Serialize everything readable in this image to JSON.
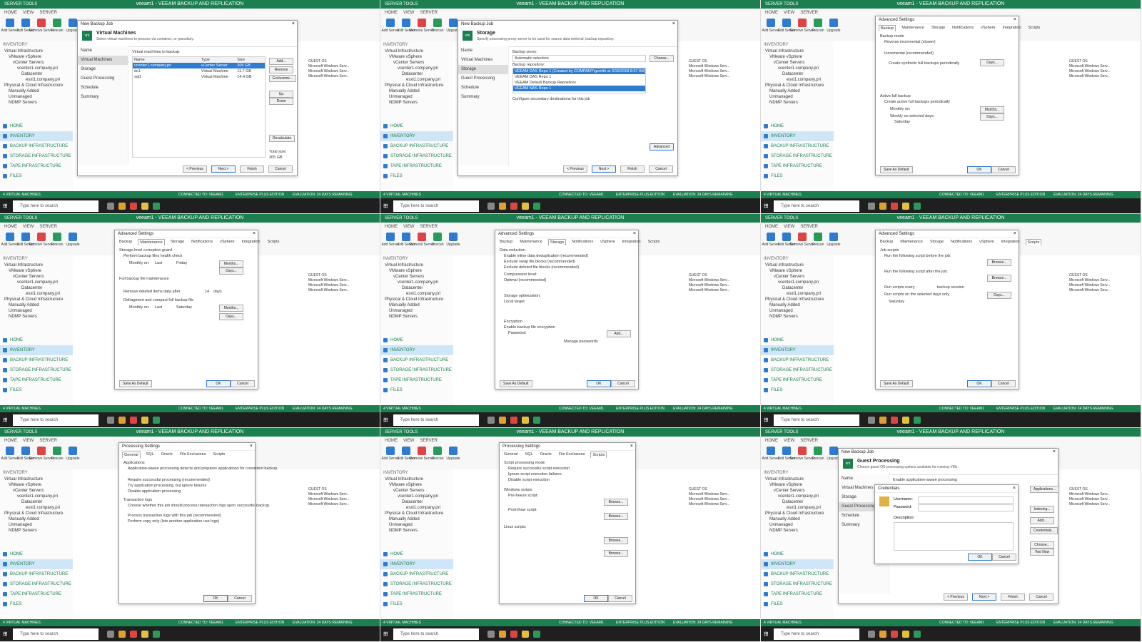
{
  "app": {
    "window_title": "veeam1 - VEEAM BACKUP AND REPLICATION",
    "server_tools": "SERVER TOOLS",
    "ribbon_tabs": [
      "HOME",
      "VIEW",
      "SERVER"
    ],
    "ribbon_buttons": [
      "Add Server",
      "Edit Server",
      "Remove Server",
      "Rescan",
      "Upgrade"
    ],
    "inventory_label": "INVENTORY",
    "tree": [
      "Virtual Infrastructure",
      "VMware vSphere",
      "vCenter Servers",
      "vcenter1.company.pri",
      "Datacenter",
      "esxi1.company.pri",
      "Physical & Cloud Infrastructure",
      "Manually Added",
      "Unmanaged",
      "NDMP Servers"
    ],
    "nav": [
      "HOME",
      "INVENTORY",
      "BACKUP INFRASTRUCTURE",
      "STORAGE INFRASTRUCTURE",
      "TAPE INFRASTRUCTURE",
      "FILES"
    ],
    "status": {
      "left": "4 VIRTUAL MACHINES",
      "connected": "CONNECTED TO: VEEAM1",
      "edition": "ENTERPRISE PLUS EDITION",
      "eval": "EVALUATION: 24 DAYS REMAINING"
    },
    "taskbar_search": "Type here to search",
    "bg_guest_os": "GUEST OS",
    "bg_os": "Microsoft Windows Serv..."
  },
  "tiles": [
    {
      "dialog_title": "New Backup Job",
      "header_title": "Virtual Machines",
      "header_sub": "Select virtual machines to process via container, or granularly.",
      "steps": [
        "Name",
        "Virtual Machines",
        "Storage",
        "Guest Processing",
        "Schedule",
        "Summary"
      ],
      "active_step": 1,
      "list_label": "Virtual machines to backup:",
      "columns": [
        "Name",
        "Type",
        "Size"
      ],
      "rows": [
        {
          "name": "vcenter1.company.pri",
          "type": "vCenter Server",
          "size": "305 GB"
        },
        {
          "name": "dc1",
          "type": "Virtual Machine",
          "size": "11.7 GB"
        },
        {
          "name": "sql1",
          "type": "Virtual Machine",
          "size": "14.4 GB"
        }
      ],
      "side_buttons": [
        "Add...",
        "Remove",
        "Exclusions...",
        "Up",
        "Down",
        "Recalculate"
      ],
      "total": "Total size:",
      "total_value": "305 GB",
      "buttons": [
        "< Previous",
        "Next >",
        "Finish",
        "Cancel"
      ]
    },
    {
      "dialog_title": "New Backup Job",
      "header_title": "Storage",
      "header_sub": "Specify processing proxy server to be used for source data retrieval, backup repository.",
      "steps": [
        "Name",
        "Virtual Machines",
        "Storage",
        "Guest Processing",
        "Schedule",
        "Summary"
      ],
      "active_step": 2,
      "proxy_label": "Backup proxy:",
      "proxy_value": "Automatic selection",
      "choose": "Choose...",
      "repo_label": "Backup repository:",
      "repo_options": [
        "VEEAM DAS Repo 1 (Created by COMPANY\\gsmith at 3/15/2018 8:57 AM)",
        "VEEAM DAS Repo 1",
        "VEEAM Default Backup Repository",
        "VEEAM NAS Repo 1"
      ],
      "secondary": "Configure secondary destinations for this job",
      "advanced": "Advanced",
      "buttons": [
        "< Previous",
        "Next >",
        "Finish",
        "Cancel"
      ]
    },
    {
      "dialog_title": "Advanced Settings",
      "tabs": [
        "Backup",
        "Maintenance",
        "Storage",
        "Notifications",
        "vSphere",
        "Integration",
        "Scripts"
      ],
      "active_tab": 0,
      "backup_mode": "Backup mode",
      "opt1": "Reverse incremental (slower)",
      "opt2": "Incremental (recommended)",
      "synth": "Create synthetic full backups periodically",
      "active_full": "Active full backup",
      "create_active": "Create active full backups periodically",
      "monthly": "Monthly on:",
      "weekly": "Weekly on selected days:",
      "day": "Saturday",
      "days_btn": "Days...",
      "months_btn": "Months...",
      "save_default": "Save As Default",
      "ok": "OK",
      "cancel": "Cancel"
    },
    {
      "dialog_title": "Advanced Settings",
      "tabs": [
        "Backup",
        "Maintenance",
        "Storage",
        "Notifications",
        "vSphere",
        "Integration",
        "Scripts"
      ],
      "active_tab": 1,
      "health": "Storage-level corruption guard",
      "health_check": "Perform backup files health check",
      "monthly": "Monthly on:",
      "last": "Last",
      "friday": "Friday",
      "full_maint": "Full backup file maintenance",
      "remove_deleted": "Remove deleted items data after",
      "days_value": "14",
      "days": "days",
      "defrag": "Defragment and compact full backup file",
      "saturday": "Saturday",
      "months_btn": "Months...",
      "days_btn": "Days...",
      "save_default": "Save As Default",
      "ok": "OK",
      "cancel": "Cancel"
    },
    {
      "dialog_title": "Advanced Settings",
      "tabs": [
        "Backup",
        "Maintenance",
        "Storage",
        "Notifications",
        "vSphere",
        "Integration",
        "Scripts"
      ],
      "active_tab": 2,
      "data_reduction": "Data reduction",
      "dedup": "Enable inline data deduplication (recommended)",
      "exclude_swap": "Exclude swap file blocks (recommended)",
      "exclude_deleted": "Exclude deleted file blocks (recommended)",
      "compression": "Compression level:",
      "compression_value": "Optimal (recommended)",
      "storage_opt": "Storage optimization:",
      "storage_value": "Local target",
      "encryption": "Encryption",
      "enable_enc": "Enable backup file encryption",
      "password": "Password:",
      "add": "Add...",
      "manage": "Manage passwords",
      "save_default": "Save As Default",
      "ok": "OK",
      "cancel": "Cancel"
    },
    {
      "dialog_title": "Advanced Settings",
      "tabs": [
        "Backup",
        "Maintenance",
        "Storage",
        "Notifications",
        "vSphere",
        "Integration",
        "Scripts"
      ],
      "active_tab": 6,
      "job_scripts": "Job scripts",
      "run_before": "Run the following script before the job:",
      "run_after": "Run the following script after the job:",
      "browse": "Browse...",
      "run_every": "Run scripts every",
      "backup_session": "backup session",
      "run_selected": "Run scripts on the selected days only",
      "days_btn": "Days...",
      "saturday": "Saturday",
      "save_default": "Save As Default",
      "ok": "OK",
      "cancel": "Cancel"
    },
    {
      "dialog_title": "Processing Settings",
      "tabs": [
        "General",
        "SQL",
        "Oracle",
        "File Exclusions",
        "Scripts"
      ],
      "active_tab": 0,
      "applications": "Applications",
      "app_desc": "Application-aware processing detects and prepares applications for consistent backup.",
      "req": "Require successful processing (recommended)",
      "try": "Try application processing, but ignore failures",
      "disable": "Disable application processing",
      "tx_logs": "Transaction logs",
      "tx_desc": "Choose whether this job should process transaction logs upon successful backup.",
      "process": "Process transaction logs with this job (recommended)",
      "copy_only": "Perform copy only (lets another application use logs)",
      "ok": "OK",
      "cancel": "Cancel"
    },
    {
      "dialog_title": "Processing Settings",
      "tabs": [
        "General",
        "SQL",
        "Oracle",
        "File Exclusions",
        "Scripts"
      ],
      "active_tab": 4,
      "mode": "Script processing mode",
      "require": "Require successful script execution",
      "ignore": "Ignore script execution failures",
      "disable": "Disable script execution",
      "windows": "Windows scripts",
      "pre_freeze": "Pre-freeze script:",
      "post_thaw": "Post-thaw script:",
      "linux": "Linux scripts",
      "browse": "Browse...",
      "ok": "OK",
      "cancel": "Cancel"
    },
    {
      "dialog_title": "New Backup Job",
      "header_title": "Guest Processing",
      "header_sub": "Choose guest OS processing options available for running VMs.",
      "steps": [
        "Name",
        "Virtual Machines",
        "Storage",
        "Guest Processing",
        "Schedule",
        "Summary"
      ],
      "active_step": 3,
      "enable_app": "Enable application-aware processing",
      "cred_title": "Credentials",
      "username": "Username:",
      "password": "Password:",
      "description": "Description:",
      "ok": "OK",
      "cancel": "Cancel",
      "side_buttons": [
        "Applications...",
        "Indexing...",
        "Add...",
        "Credentials...",
        "Choose...",
        "Test Now"
      ],
      "buttons": [
        "< Previous",
        "Next >",
        "Finish",
        "Cancel"
      ]
    }
  ]
}
